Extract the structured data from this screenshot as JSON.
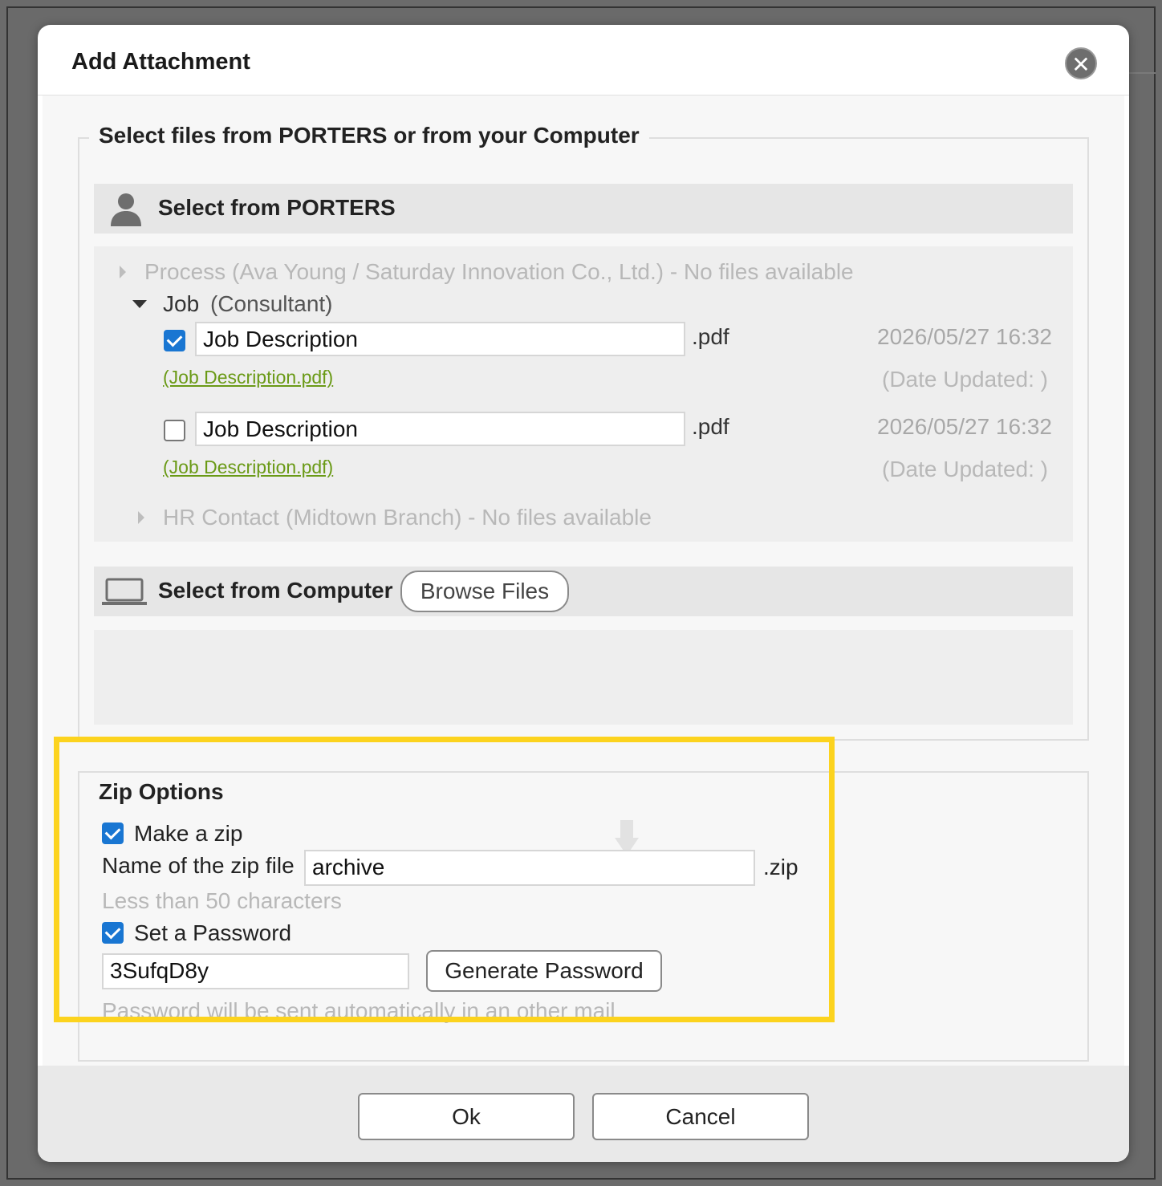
{
  "dialog": {
    "title": "Add Attachment",
    "close_glyph": "✕"
  },
  "select_group": {
    "legend": "Select files from PORTERS or from your Computer",
    "porters": {
      "heading": "Select from PORTERS",
      "process": {
        "label": "Process",
        "detail": "(Ava Young / Saturday Innovation Co., Ltd.) - No files available"
      },
      "job": {
        "label": "Job",
        "detail": "(Consultant)",
        "files": [
          {
            "checked": true,
            "name": "Job Description",
            "ext": ".pdf",
            "date": "2026/05/27 16:32",
            "link": "(Job Description.pdf)",
            "updated": "(Date Updated: )"
          },
          {
            "checked": false,
            "name": "Job Description",
            "ext": ".pdf",
            "date": "2026/05/27 16:32",
            "link": "(Job Description.pdf)",
            "updated": "(Date Updated: )"
          }
        ]
      },
      "hr_contact": {
        "label": "HR Contact",
        "detail": "(Midtown Branch) - No files available"
      }
    },
    "computer": {
      "heading": "Select from Computer",
      "browse_label": "Browse Files"
    }
  },
  "zip_options": {
    "legend": "Zip Options",
    "make_zip": {
      "checked": true,
      "label": "Make a zip"
    },
    "zip_name_label": "Name of the zip file",
    "zip_name_value": "archive",
    "zip_ext": ".zip",
    "zip_hint": "Less than 50 characters",
    "set_password": {
      "checked": true,
      "label": "Set a Password"
    },
    "password_value": "3SufqD8y",
    "generate_label": "Generate Password",
    "password_hint": "Password will be sent automatically in an other mail"
  },
  "footer": {
    "ok_label": "Ok",
    "cancel_label": "Cancel"
  },
  "colors": {
    "highlight": "#fcd31e",
    "checkbox": "#1976d2",
    "link": "#6a9a16"
  }
}
